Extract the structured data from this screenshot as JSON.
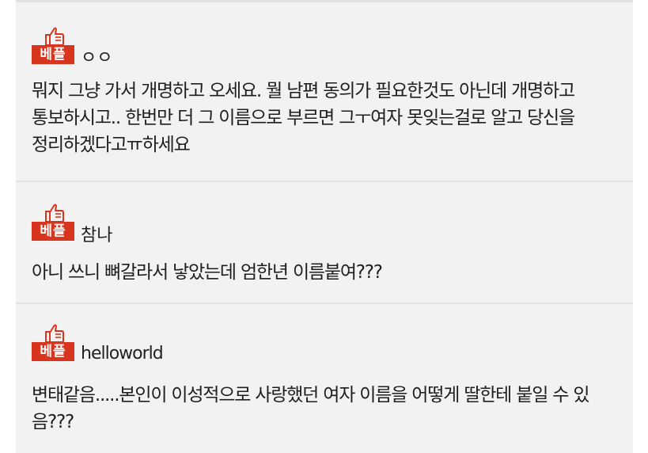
{
  "comments": [
    {
      "badge": "베플",
      "username": "ㅇㅇ",
      "lines": [
        "뭐지 그냥 가서 개명하고 오세요. 뭘 남편 동의가 필요한것도 아닌데 개명하고",
        "통보하시고.. 한번만 더 그 이름으로 부르면 그ㅜ여자 못잊는걸로 알고 당신을",
        "정리하겠다고ㅠ하세요"
      ]
    },
    {
      "badge": "베플",
      "username": "참나",
      "lines": [
        "아니 쓰니 뼈갈라서 낳았는데 엄한년 이름붙여???"
      ]
    },
    {
      "badge": "베플",
      "username": "helloworld",
      "lines": [
        "변태같음.....본인이 이성적으로 사랑했던 여자 이름을 어떻게 딸한테 붙일 수 있",
        "음???"
      ]
    }
  ],
  "colors": {
    "badge_red": "#d8351f",
    "panel_bg": "#f2f2f2",
    "divider": "#e3e3e3",
    "text": "#1e1e1e"
  },
  "icons": {
    "badge_icon": "thumbs-up-icon"
  }
}
